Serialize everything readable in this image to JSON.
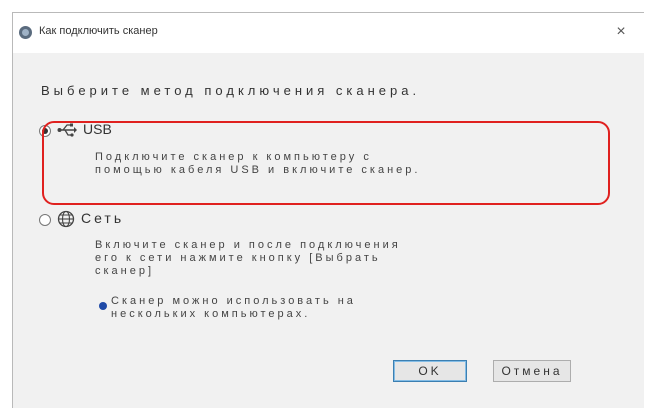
{
  "window": {
    "title": "Как подключить сканер",
    "close_glyph": "×"
  },
  "heading": "Выберите метод подключения сканера.",
  "options": [
    {
      "label": "USB",
      "icon": "usb-icon",
      "selected": true,
      "description": "Подключите сканер к компьютеру с\nпомощью кабеля USB и включите сканер."
    },
    {
      "label": "Сеть",
      "icon": "globe-icon",
      "selected": false,
      "description": "Включите сканер и после подключения\nего к сети нажмите кнопку [Выбрать\nсканер]",
      "note": "Сканер можно использовать на\nнескольких компьютерах."
    }
  ],
  "buttons": {
    "ok": "OK",
    "cancel": "Отмена"
  },
  "colors": {
    "highlight": "#e0211f",
    "info_dot": "#1f4aa7"
  }
}
